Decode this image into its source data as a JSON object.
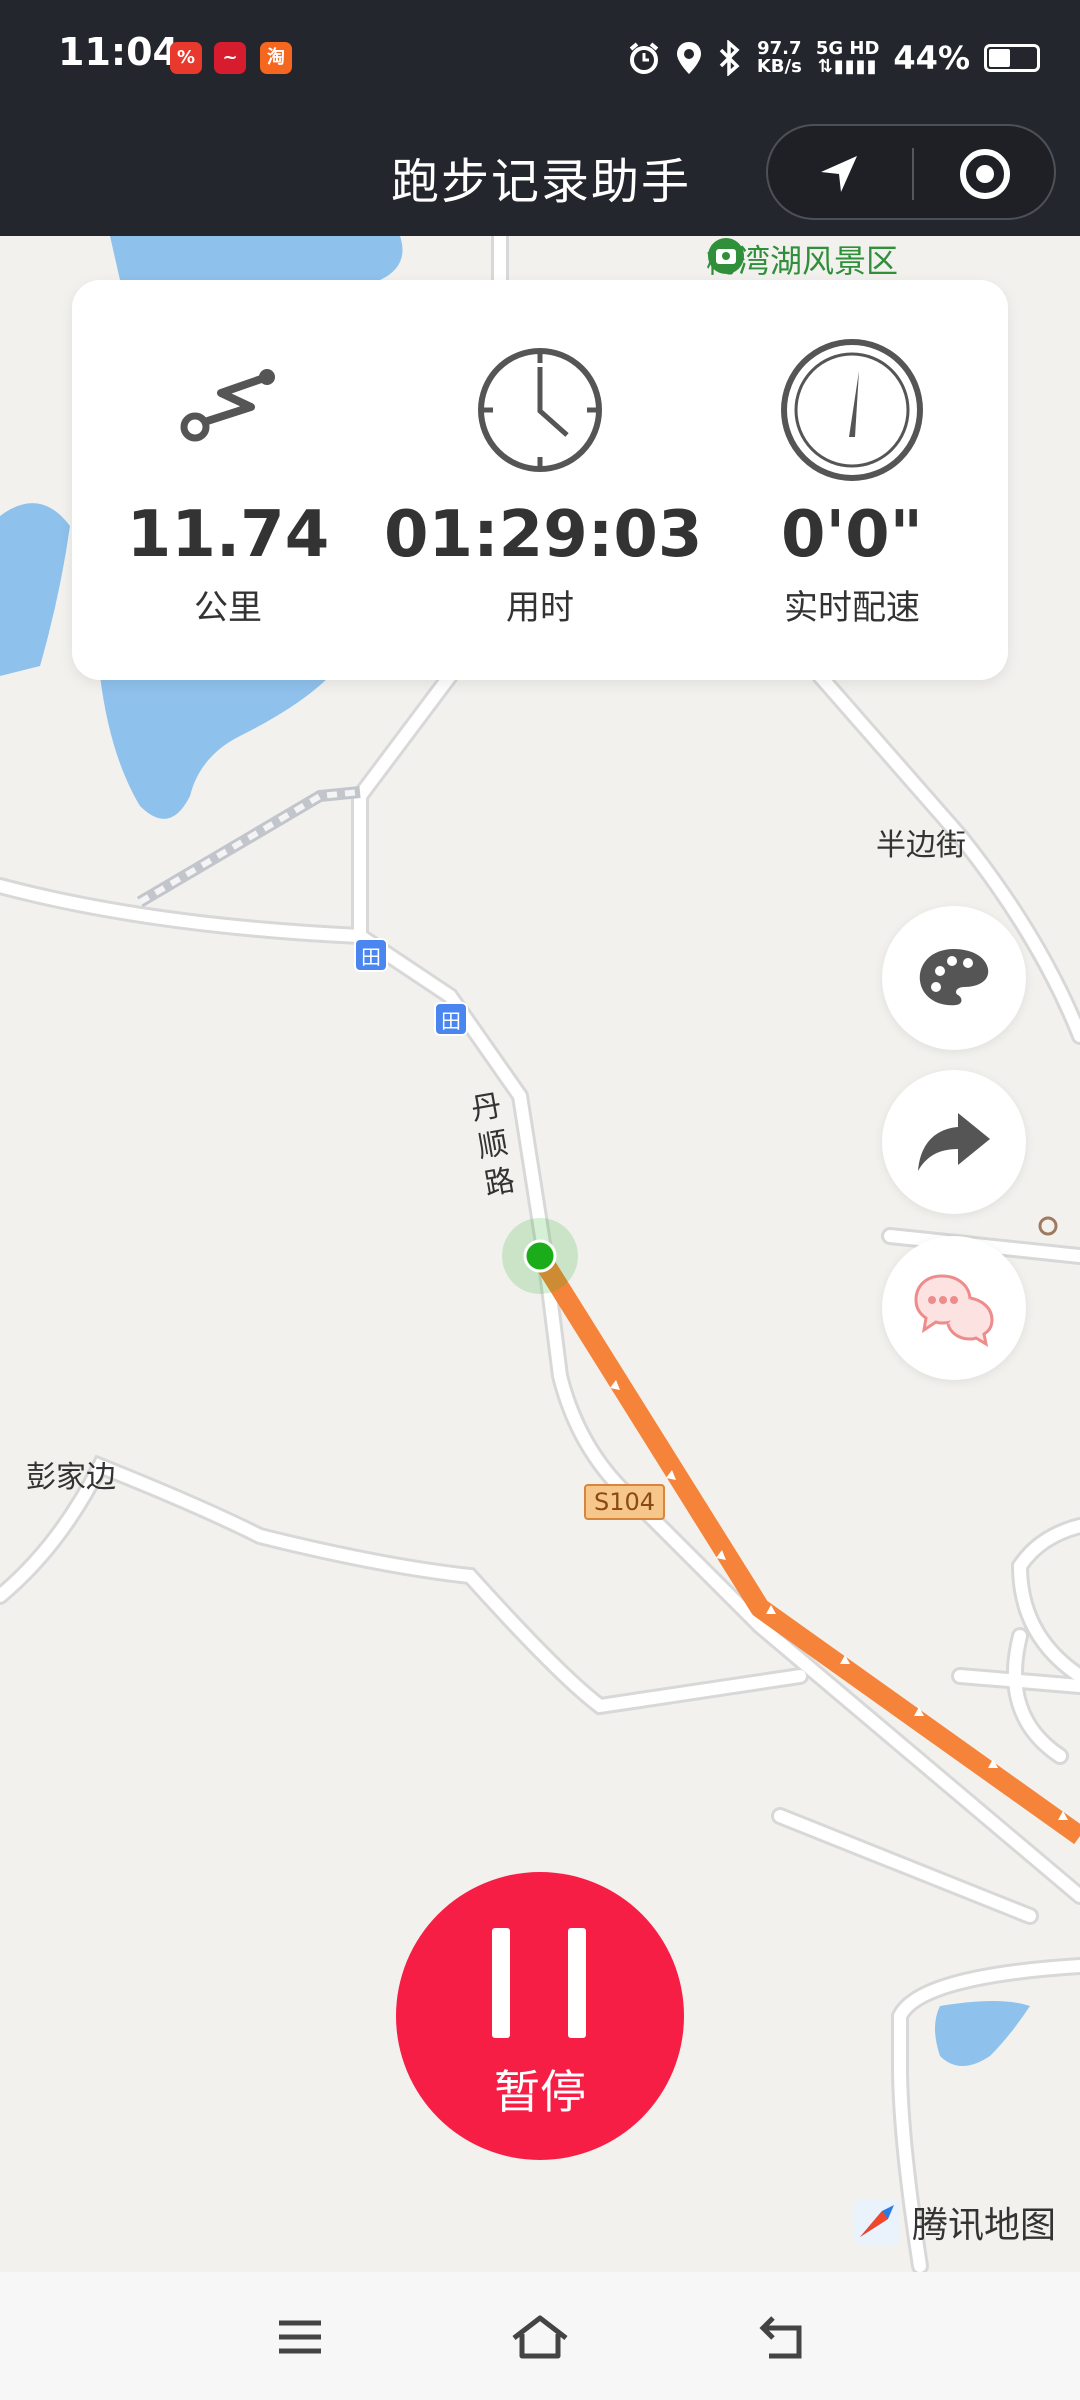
{
  "status_bar": {
    "time": "11:04",
    "app_badges": [
      "%",
      "~",
      "淘"
    ],
    "network_speed_top": "97.7",
    "network_speed_bottom": "KB/s",
    "network_type_top": "5G HD",
    "battery_percent": "44%",
    "battery_level": 0.44
  },
  "header": {
    "title": "跑步记录助手"
  },
  "stats": {
    "distance_value": "11.74",
    "distance_label": "公里",
    "time_value": "01:29:03",
    "time_label": "用时",
    "pace_value": "0'0\"",
    "pace_label": "实时配速"
  },
  "map": {
    "poi_meiwan": "梅湾湖风景区",
    "place_banbian": "半边街",
    "place_pengjia": "彭家边",
    "road_name": "丹顺路",
    "road_badge": "S104",
    "attribution": "腾讯地图",
    "bus_icon_text": "田",
    "route_color": "#f5843a",
    "position_color": "#1aad19"
  },
  "controls": {
    "pause_label": "暂停"
  },
  "colors": {
    "header_bg": "#24262d",
    "pause_bg": "#f71e46"
  }
}
